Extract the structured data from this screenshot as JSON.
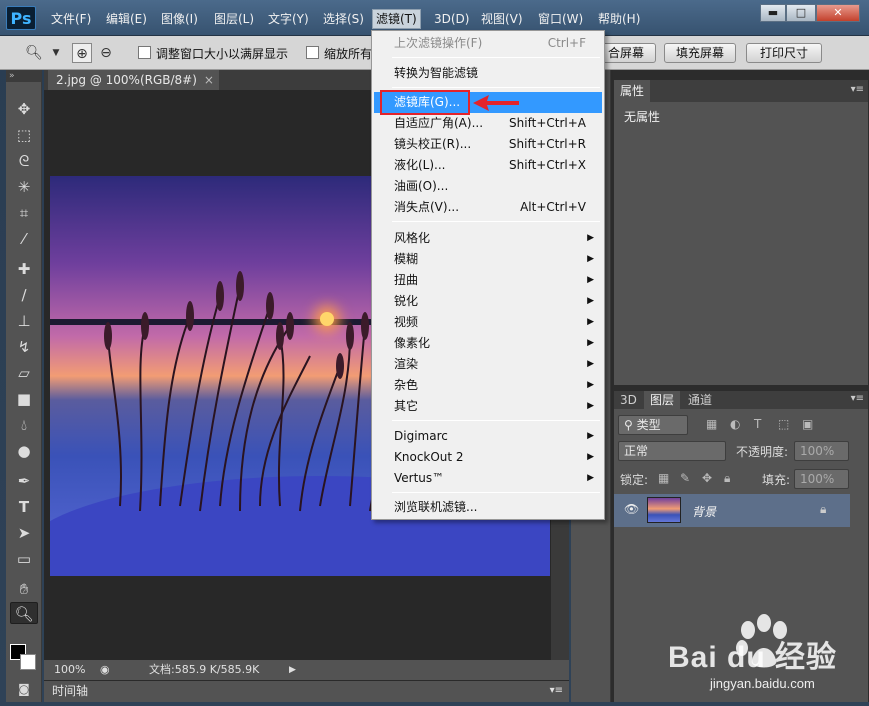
{
  "app": {
    "logo": "Ps"
  },
  "menubar": {
    "items": [
      "文件(F)",
      "编辑(E)",
      "图像(I)",
      "图层(L)",
      "文字(Y)",
      "选择(S)",
      "滤镜(T)",
      "3D(D)",
      "视图(V)",
      "窗口(W)",
      "帮助(H)"
    ]
  },
  "window_controls": {
    "minimize": "▬",
    "maximize": "□",
    "close": "✕"
  },
  "options": {
    "resize_windows_label": "调整窗口大小以满屏显示",
    "zoom_all_label": "缩放所有",
    "fit_screen_button": "合屏幕",
    "fill_screen_button": "填充屏幕",
    "print_size_button": "打印尺寸"
  },
  "document": {
    "tab_title": "2.jpg @ 100%(RGB/8#)",
    "tab_close": "×",
    "zoom": "100%",
    "doc_info": "文档:585.9 K/585.9K"
  },
  "timeline": {
    "label": "时间轴"
  },
  "properties_panel": {
    "tab": "属性",
    "content": "无属性"
  },
  "layers_panel": {
    "tabs": [
      "3D",
      "图层",
      "通道"
    ],
    "kind_filter": "类型",
    "blend_mode": "正常",
    "opacity_label": "不透明度:",
    "opacity_value": "100%",
    "lock_label": "锁定:",
    "fill_label": "填充:",
    "fill_value": "100%",
    "layer_name": "背景"
  },
  "filter_menu": {
    "last_filter": {
      "label": "上次滤镜操作(F)",
      "shortcut": "Ctrl+F"
    },
    "convert_smart": "转换为智能滤镜",
    "filter_gallery": "滤镜库(G)...",
    "adaptive_wide_angle": {
      "label": "自适应广角(A)...",
      "shortcut": "Shift+Ctrl+A"
    },
    "lens_correction": {
      "label": "镜头校正(R)...",
      "shortcut": "Shift+Ctrl+R"
    },
    "liquify": {
      "label": "液化(L)...",
      "shortcut": "Shift+Ctrl+X"
    },
    "oil_paint": "油画(O)...",
    "vanishing_point": {
      "label": "消失点(V)...",
      "shortcut": "Alt+Ctrl+V"
    },
    "submenus": [
      "风格化",
      "模糊",
      "扭曲",
      "锐化",
      "视频",
      "像素化",
      "渲染",
      "杂色",
      "其它"
    ],
    "plugins": [
      "Digimarc",
      "KnockOut 2",
      "Vertus™"
    ],
    "browse_online": "浏览联机滤镜..."
  },
  "watermark": {
    "brand": "Bai du 经验",
    "url": "jingyan.baidu.com"
  },
  "colors": {
    "highlight": "#3399ff",
    "annotation": "#e3232b",
    "panel": "#535353"
  }
}
